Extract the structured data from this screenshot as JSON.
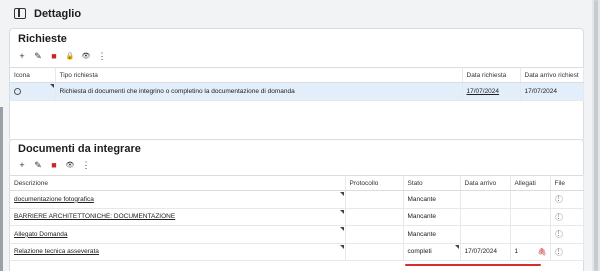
{
  "header": {
    "title": "Dettaglio",
    "pane_icon": "side-panel-icon"
  },
  "richieste": {
    "title": "Richieste",
    "toolbar": [
      "plus-icon",
      "pencil-icon",
      "trash-icon",
      "lock-icon",
      "eye-icon",
      "more-vert-icon"
    ],
    "toolbar_glyphs": [
      "+",
      "✎",
      "■",
      "🔒",
      "👁",
      "⋮"
    ],
    "columns": [
      "Icona",
      "Tipo richiesta",
      "Data richiesta",
      "Data arrivo richiest"
    ],
    "rows": [
      {
        "icona": "radio-icon",
        "tipo": "Richiesta di documenti che integrino o completino la documentazione di domanda",
        "data_richiesta": "17/07/2024",
        "data_arrivo": "17/07/2024"
      }
    ]
  },
  "documenti": {
    "title": "Documenti da integrare",
    "toolbar": [
      "plus-icon",
      "pencil-icon",
      "trash-icon",
      "eye-icon",
      "more-vert-icon"
    ],
    "toolbar_glyphs": [
      "+",
      "✎",
      "■",
      "👁",
      "⋮"
    ],
    "columns": [
      "Descrizione",
      "Protocollo",
      "Stato",
      "Data arrivo",
      "Allegati",
      "File"
    ],
    "rows": [
      {
        "descrizione": "documentazione fotografica",
        "protocollo": "",
        "stato": "Mancante",
        "data_arrivo": "",
        "allegati": "",
        "file": "⋮"
      },
      {
        "descrizione": "BARRIERE ARCHITETTONICHE: DOCUMENTAZIONE",
        "protocollo": "",
        "stato": "Mancante",
        "data_arrivo": "",
        "allegati": "",
        "file": "⋮"
      },
      {
        "descrizione": "Allegato Domanda",
        "protocollo": "",
        "stato": "Mancante",
        "data_arrivo": "",
        "allegati": "",
        "file": "⋮"
      },
      {
        "descrizione": "Relazione tecnica asseverata",
        "protocollo": "",
        "stato": "completi",
        "data_arrivo": "17/07/2024",
        "allegati": "1",
        "file": "⋮"
      }
    ]
  },
  "colors": {
    "selected_row": "#e3eefb",
    "delete": "#c62828",
    "highlight_underline": "#d32f2f"
  }
}
